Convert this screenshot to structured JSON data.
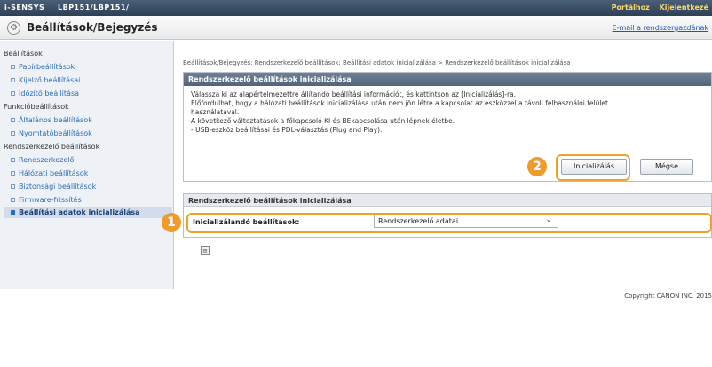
{
  "topbar": {
    "brand": "i-SENSYS",
    "model": "LBP151/LBP151/",
    "links": [
      "Portálhoz",
      "Kijelentkezé"
    ]
  },
  "header": {
    "icon": "gear-icon",
    "title": "Beállítások/Bejegyzés",
    "email_link": "E-mail a rendszergazdának"
  },
  "sidebar": {
    "sections": [
      {
        "label": "Beállítások",
        "items": [
          "Papírbeállítások",
          "Kijelző beállításai",
          "Időzítő beállítása"
        ]
      },
      {
        "label": "Funkcióbeállítások",
        "items": [
          "Általános beállítások",
          "Nyomtatóbeállítások"
        ]
      },
      {
        "label": "Rendszerkezelő beállítások",
        "items": [
          "Rendszerkezelő",
          "Hálózati beállítások",
          "Biztonsági beállítások",
          "Firmware-frissítés",
          "Beállítási adatok inicializálása"
        ]
      }
    ]
  },
  "breadcrumb": "Beállítások/Bejegyzés: Rendszerkezelő beállítások: Beállítási adatok inicializálása > Rendszerkezelő beállítások inicializálása",
  "init_panel": {
    "title": "Rendszerkezelő beállítások inicializálása",
    "lines": [
      "Válassza ki az alapértelmezettre állítandó beállítási információt, és kattintson az [Inicializálás]-ra.",
      "Előfordulhat, hogy a hálózati beállítások inicializálása után nem jön létre a kapcsolat az eszközzel a távoli felhasználói felület",
      "használatával.",
      "A következő változtatások a főkapcsoló KI és BEkapcsolása után lépnek életbe.",
      "- USB-eszköz beállításai és PDL-választás (Plug and Play)."
    ],
    "init_button": "Inicializálás",
    "cancel_button": "Mégse"
  },
  "settings_panel": {
    "title": "Rendszerkezelő beállítások inicializálása",
    "row_label": "Inicializálandó beállítások:",
    "selected_value": "Rendszerkezelő adatai"
  },
  "callouts": [
    "1",
    "2"
  ],
  "copyright": "Copyright CANON INC. 2015",
  "colors": {
    "topbar": "#2e3f55",
    "accent": "#f19a2b",
    "link": "#2b6cb8"
  }
}
